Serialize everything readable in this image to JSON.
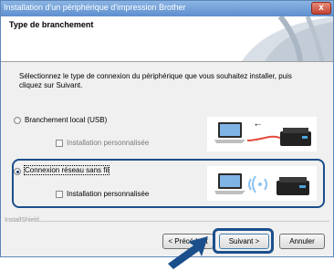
{
  "window": {
    "title": "Installation d'un périphérique d'impression Brother",
    "close_label": "x"
  },
  "header": {
    "title": "Type de branchement"
  },
  "instruction": "Sélectionnez le type de connexion du périphérique que vous souhaitez installer, puis cliquez sur Suivant.",
  "options": [
    {
      "label": "Branchement local (USB)",
      "selected": false,
      "custom_install_label": "Installation personnalisée",
      "custom_install_checked": false,
      "custom_install_enabled": false,
      "illustration_icon": "laptop-usb-printer-icon"
    },
    {
      "label": "Connexion réseau sans fil",
      "selected": true,
      "custom_install_label": "Installation personnalisée",
      "custom_install_checked": false,
      "custom_install_enabled": true,
      "illustration_icon": "laptop-wireless-printer-icon"
    }
  ],
  "footer": {
    "brand": "InstallShield",
    "back_label": "< Précédent",
    "next_label": "Suivant >",
    "cancel_label": "Annuler"
  },
  "annotation_colors": {
    "highlight": "#1b4f8c"
  }
}
